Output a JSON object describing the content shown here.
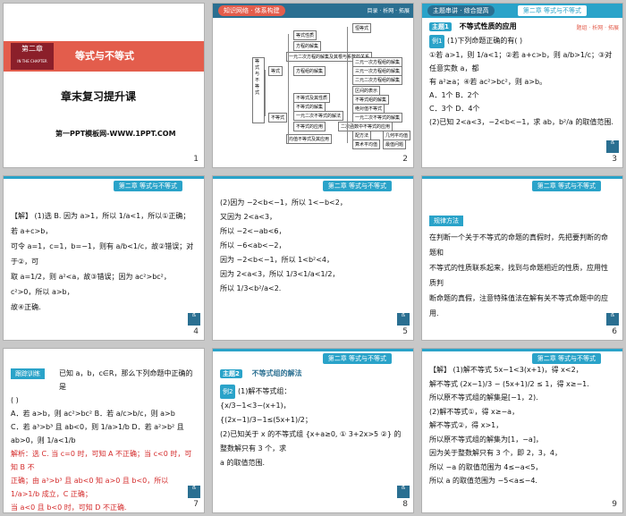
{
  "slides": [
    {
      "num": "1",
      "chapter_label": "第二章",
      "chapter_en": "IN THE CHAPTER",
      "title": "等式与不等式",
      "subtitle": "章末复习提升课",
      "url": "第一PPT模板网-WWW.1PPT.COM"
    },
    {
      "num": "2",
      "header_pill": "知识网络 · 体系构建",
      "header_right": "目录 · 析网 · 拓展",
      "mm_root": "等式与不等式",
      "mm_l1": [
        "等式",
        "不等式"
      ],
      "mm_l2": [
        "等式性质",
        "方程的解集",
        "一元二次方程的解集及其根与系数的关系",
        "方程组的解集",
        "不等式及其性质",
        "不等式的解集",
        "一元二次不等式的解法",
        "不等式的应用",
        "均值不等式及其应用"
      ],
      "mm_l3": [
        "恒等式",
        "二元一次方程组的解集",
        "三元一次方程组的解集",
        "二元二次方程组的解集",
        "区间的表示",
        "不等式组的解集",
        "绝对值不等式",
        "一元二次不等式的解集",
        "二次函数中不等式的应用",
        "配方法",
        "算术平均值",
        "几何平均值",
        "最值问题"
      ]
    },
    {
      "num": "3",
      "header_left": "主题串讲 · 综合提高",
      "header_chip": "第二章 等式与不等式",
      "header_right": "题组 · 析网 · 拓展",
      "topic": "主题1",
      "topic_title": "不等式性质的应用",
      "ex": "例1",
      "lines": [
        "(1)下列命题正确的有(    )",
        "①若 a>1，则 1/a<1；②若 a+c>b，则 a/b>1/c；③对任意实数 a，都",
        "有 a²≥a；④若 ac²>bc²，则 a>b。",
        "A．1个                        B．2个",
        "C．3个                        D．4个",
        "(2)已知 2<a<3，−2<b<−1，求 ab，b²/a 的取值范围."
      ]
    },
    {
      "num": "4",
      "header_chip": "第二章 等式与不等式",
      "lines": [
        "【解】 (1)选 B. 因为 a>1，所以 1/a<1，所以①正确；若 a+c>b，",
        "可令 a=1，c=1，b=−1，则有 a/b<1/c，故②错误；对于②，可",
        "取 a=1/2，则 a²<a，故③错误；因为 ac²>bc²，c²>0，所以 a>b，",
        "故④正确."
      ]
    },
    {
      "num": "5",
      "header_chip": "第二章 等式与不等式",
      "lines": [
        "(2)因为 −2<b<−1，所以 1<−b<2，",
        "又因为 2<a<3，",
        "所以 −2<−ab<6，",
        "所以 −6<ab<−2，",
        "因为 −2<b<−1，所以 1<b²<4，",
        "因为 2<a<3，所以 1/3<1/a<1/2，",
        "所以 1/3<b²/a<2."
      ]
    },
    {
      "num": "6",
      "header_chip": "第二章 等式与不等式",
      "tag": "规律方法",
      "lines": [
        "在判断一个关于不等式的命题的真假时，先把要判断的命题和",
        "不等式的性质联系起来，找到与命题相近的性质，应用性质判",
        "断命题的真假，注意特殊值法在解有关不等式命题中的应用."
      ]
    },
    {
      "num": "7",
      "tag": "跟踪训练",
      "lines": [
        "已知 a，b，c∈R，那么下列命题中正确的是",
        "(    )",
        "A．若 a>b，则 ac²>bc²        B．若 a/c>b/c，则 a>b",
        "C．若 a³>b³ 且 ab<0，则 1/a>1/b   D．若 a²>b² 且 ab>0，则 1/a<1/b",
        "解析：选 C. 当 c=0 时，可知 A 不正确；当 c<0 时，可知 B 不",
        "正确；由 a³>b³ 且 ab<0 知 a>0 且 b<0，所以 1/a>1/b 成立，C 正确；",
        "当 a<0 且 b<0 时，可知 D 不正确."
      ]
    },
    {
      "num": "8",
      "header_chip": "第二章 等式与不等式",
      "topic": "主题2",
      "topic_title": "不等式组的解法",
      "ex": "例2",
      "lines": [
        "(1)解不等式组：",
        "{x/3−1<3−(x+1)，",
        "{(2x−1)/3−1≤(5x+1)/2；",
        "(2)已知关于 x 的不等式组 {x+a≥0, ①  3+2x>5 ②} 的整数解只有 3 个，求",
        "a 的取值范围."
      ]
    },
    {
      "num": "9",
      "header_chip": "第二章 等式与不等式",
      "lines": [
        "【解】 (1)解不等式 5x−1<3(x+1)，得 x<2，",
        "解不等式 (2x−1)/3 − (5x+1)/2 ≤ 1，得 x≥−1.",
        "所以原不等式组的解集是[−1，2).",
        "(2)解不等式①，得 x≥−a，",
        "解不等式②，得 x>1，",
        "所以原不等式组的解集为[1，−a]，",
        "因为关于整数解只有 3 个，即 2，3，4，",
        "所以 −a 的取值范围为 4≤−a<5，",
        "所以 a 的取值范围为 −5<a≤−4."
      ]
    }
  ],
  "footer_mark": "ẞ"
}
